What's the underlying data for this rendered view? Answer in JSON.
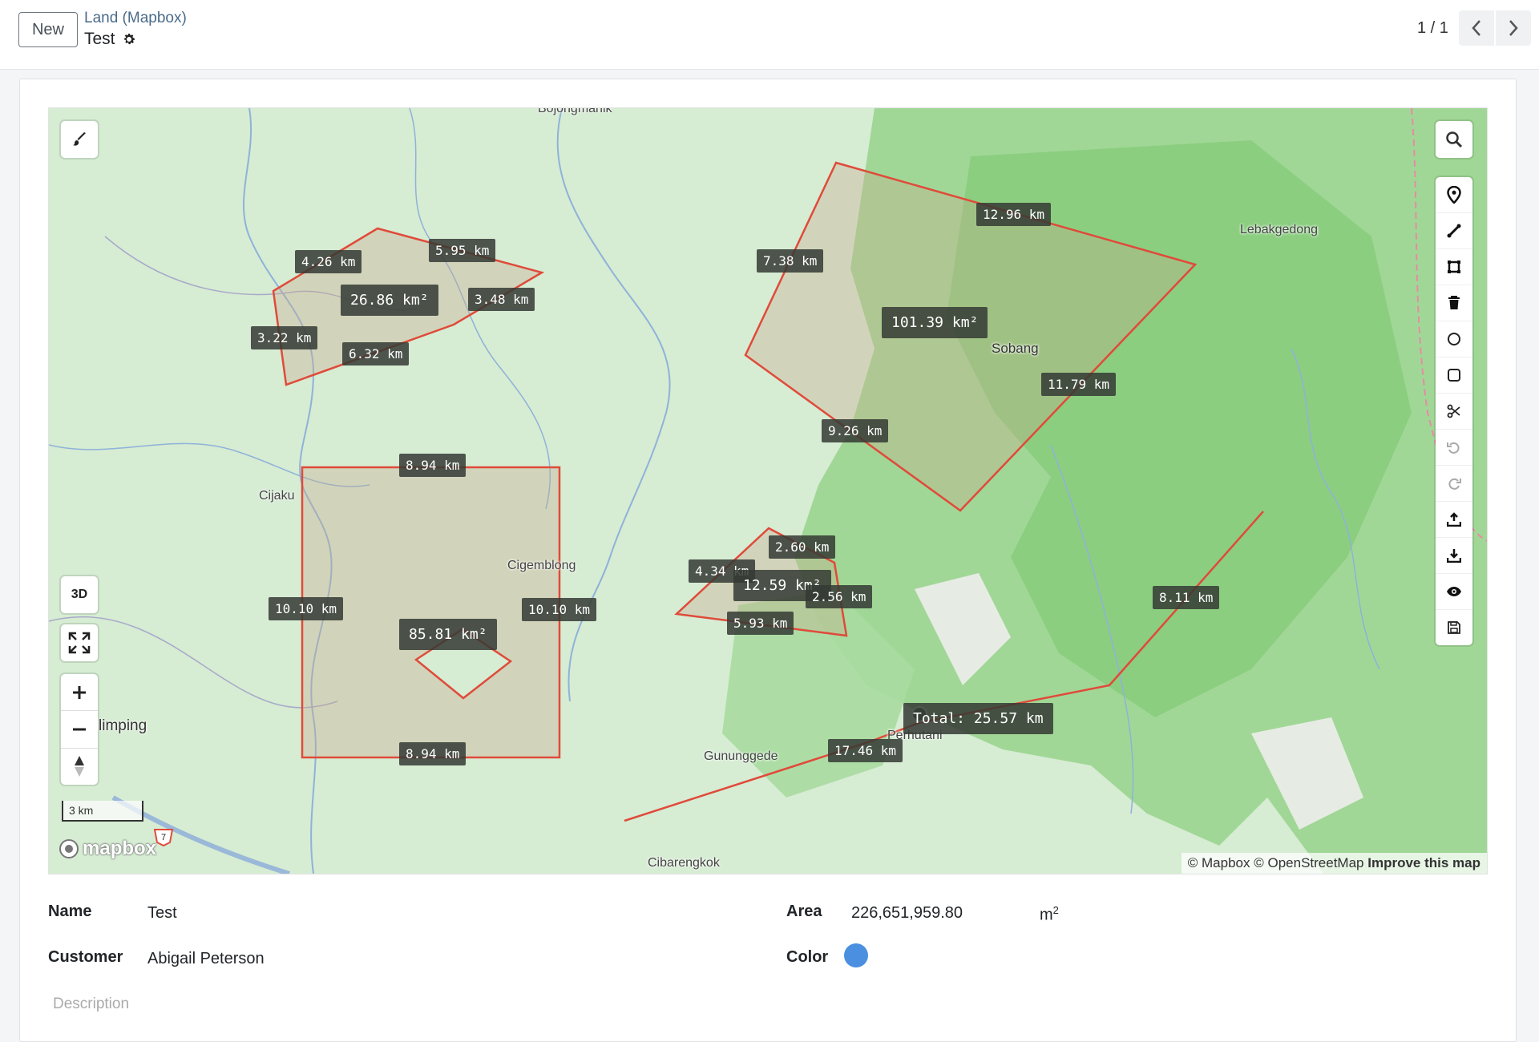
{
  "header": {
    "new_button": "New",
    "breadcrumb": "Land (Mapbox)",
    "record_title": "Test",
    "pager": "1 / 1"
  },
  "map": {
    "controls": {
      "three_d": "3D"
    },
    "scale_label": "3 km",
    "logo_text": "mapbox",
    "attribution": {
      "mapbox": "© Mapbox",
      "osm": "© OpenStreetMap",
      "improve": "Improve this map"
    },
    "places": {
      "sobang": "Sobang",
      "lebakgedong": "Lebakgedong",
      "cijaku": "Cijaku",
      "cigemblong": "Cigemblong",
      "gununggede": "Gununggede",
      "cibarengkok": "Cibarengkok",
      "perhutani": "Perhutani",
      "cimping": "limping",
      "top": "Bojongmanik",
      "road_shield": "7"
    },
    "measurements": {
      "p1_a": "4.26 km",
      "p1_b": "5.95 km",
      "p1_area": "26.86 km²",
      "p1_c": "3.48 km",
      "p1_d": "3.22 km",
      "p1_e": "6.32 km",
      "p2_a": "12.96 km",
      "p2_b": "7.38 km",
      "p2_area": "101.39 km²",
      "p2_c": "11.79 km",
      "p2_d": "9.26 km",
      "p3_a": "8.94 km",
      "p3_b": "10.10 km",
      "p3_c": "10.10 km",
      "p3_area": "85.81 km²",
      "p3_d": "8.94 km",
      "p4_a": "2.60 km",
      "p4_b": "4.34 km",
      "p4_area": "12.59 km²",
      "p4_c": "2.56 km",
      "p4_d": "5.93 km",
      "line_a": "8.11 km",
      "line_total": "Total: 25.57 km",
      "line_b": "17.46 km"
    }
  },
  "fields": {
    "name_label": "Name",
    "name_value": "Test",
    "customer_label": "Customer",
    "customer_value": "Abigail Peterson",
    "area_label": "Area",
    "area_value": "226,651,959.80",
    "area_unit": "m",
    "color_label": "Color",
    "color_value": "#4a8fe0",
    "description_placeholder": "Description"
  }
}
